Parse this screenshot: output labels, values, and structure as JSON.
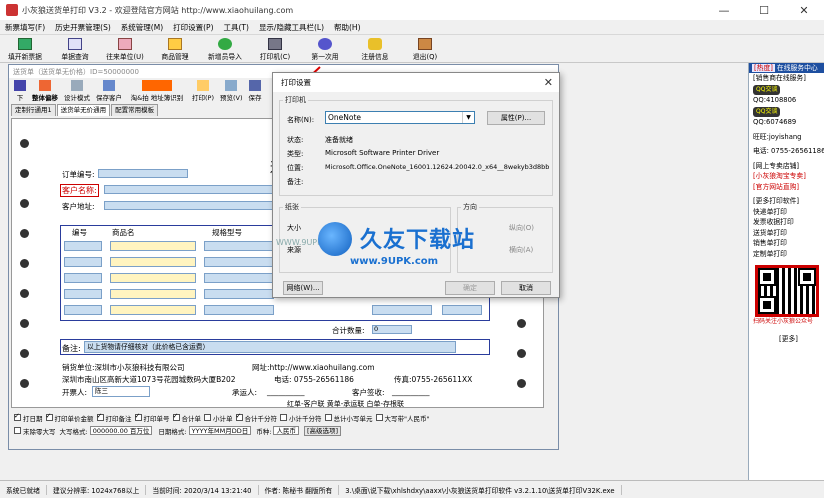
{
  "window": {
    "title": "小灰狼送货单打印 V3.2 - 欢迎登陆官方网站 http://www.xiaohuilang.com",
    "controls": [
      "—",
      "☐",
      "✕"
    ]
  },
  "menu": [
    "新票填写(F)",
    "历史开票管理(S)",
    "系统管理(M)",
    "打印设置(P)",
    "工具(T)",
    "显示/隐藏工具栏(L)",
    "帮助(H)"
  ],
  "toolbar": [
    {
      "label": "填开新票据",
      "icon": "new-doc-icon"
    },
    {
      "label": "单据查询",
      "icon": "query-icon"
    },
    {
      "label": "往来单位(U)",
      "icon": "company-icon"
    },
    {
      "label": "商品管理",
      "icon": "goods-icon"
    },
    {
      "label": "新增员导入",
      "icon": "import-icon"
    },
    {
      "label": "打印机(C)",
      "icon": "printer-icon"
    },
    {
      "label": "第一次用",
      "icon": "first-use-icon"
    },
    {
      "label": "注册信息",
      "icon": "register-icon"
    },
    {
      "label": "退出(Q)",
      "icon": "exit-icon"
    }
  ],
  "sub": {
    "title": "送货单（送货单无价格）ID=50000000",
    "tools": [
      "下",
      "整体偏移",
      "设计模式",
      "保存客户",
      "淘&拍 地址簿识别",
      "打印(P)",
      "预览(V)",
      "保存"
    ],
    "tabs": [
      "定制行通用1",
      "送货单无价通用",
      "配置常用模板"
    ],
    "active_tab": 1
  },
  "paper": {
    "title": "送",
    "order_no_label": "订单编号:",
    "customer_name_label": "客户名称:",
    "customer_addr_label": "客户地址:",
    "columns": [
      "编号",
      "商品名",
      "规格型号"
    ],
    "total_qty_label": "合计数量:",
    "total_qty_value": "0",
    "remark_label": "备注:",
    "remark_text": "以上货物请仔细核对（此价格已含运费）",
    "seller": "销货单位:深圳市小灰狼科技有限公司",
    "website": "网址:http://www.xiaohuilang.com",
    "address": "深圳市南山区高新大道1073号花园城数码大厦B202",
    "phone": "电话: 0755-26561186",
    "fax": "传真:0755-265611XX",
    "issuer_label": "开票人:",
    "issuer_value": "陈三",
    "carrier_label": "承运人:",
    "signer_label": "客户签收:",
    "copies": "红单-客户联    黄单-承运联    白单-存根联"
  },
  "options": {
    "row1": [
      {
        "label": "打日期",
        "on": true
      },
      {
        "label": "打印单价金额",
        "on": true
      },
      {
        "label": "打印备注",
        "on": true
      },
      {
        "label": "打印单号",
        "on": true
      },
      {
        "label": "合计单",
        "on": true
      },
      {
        "label": "小计单",
        "on": false
      },
      {
        "label": "合计千分符",
        "on": true
      },
      {
        "label": "小计千分符",
        "on": false
      },
      {
        "label": "总计小写单元",
        "on": false
      },
      {
        "label": "大写带\"人民币\"",
        "on": false
      }
    ],
    "row2": {
      "no_zero": "末除零大写",
      "case_label": "大写格式:",
      "case_value": "000000.00 百万位",
      "date_label": "日期格式:",
      "date_value": "YYYY年MM月DD日",
      "currency_label": "币种:",
      "currency_value": "人民币",
      "more_btn": "[高级选项]"
    }
  },
  "dialog": {
    "title": "打印设置",
    "close": "✕",
    "printer_group": "打印机",
    "name_label": "名称(N):",
    "name_value": "OneNote",
    "props_btn": "属性(P)...",
    "status_label": "状态:",
    "status_value": "准备就绪",
    "type_label": "类型:",
    "type_value": "Microsoft Software Printer Driver",
    "where_label": "位置:",
    "where_value": "Microsoft.Office.OneNote_16001.12624.20042.0_x64__8wekyb3d8bb",
    "comment_label": "备注:",
    "paper_group": "纸张",
    "size_label": "大小",
    "orient_group": "方向",
    "portrait": "纵向(O)",
    "landscape": "横向(A)",
    "source_label": "来源",
    "network_btn": "网络(W)...",
    "ok_btn": "确定",
    "cancel_btn": "取消"
  },
  "watermark": {
    "cn": "久友下载站",
    "url": "www.9UPK.com",
    "prefix": "WWW.9UPK.CO"
  },
  "side": {
    "header_hot": "[热度]",
    "header": "在线服务中心",
    "lines": [
      {
        "text": "[销售商在线服务]",
        "cls": ""
      },
      {
        "text": "QQ交谈",
        "cls": "qq"
      },
      {
        "text": "QQ:4108806",
        "cls": ""
      },
      {
        "text": "QQ交谈",
        "cls": "qq"
      },
      {
        "text": "QQ:6074689",
        "cls": ""
      },
      {
        "text": "",
        "cls": ""
      },
      {
        "text": "旺旺:joyishang",
        "cls": ""
      },
      {
        "text": "",
        "cls": ""
      },
      {
        "text": "电话: 0755-26561186",
        "cls": ""
      },
      {
        "text": "",
        "cls": ""
      },
      {
        "text": "[网上专卖店铺]",
        "cls": ""
      },
      {
        "text": "[小灰狼淘宝专卖]",
        "cls": "red"
      },
      {
        "text": "[官方网站直购]",
        "cls": "red"
      },
      {
        "text": "",
        "cls": ""
      },
      {
        "text": "[更多打印软件]",
        "cls": ""
      },
      {
        "text": "快递单打印",
        "cls": ""
      },
      {
        "text": "发票收据打印",
        "cls": ""
      },
      {
        "text": "送货单打印",
        "cls": ""
      },
      {
        "text": "销售单打印",
        "cls": ""
      },
      {
        "text": "定制单打印",
        "cls": ""
      }
    ],
    "ad_caption": "扫码关注小灰狼公众号",
    "more": "[更多]"
  },
  "status": [
    "系统已就绪",
    "建议分辨率: 1024x768以上",
    "当前时间: 2020/3/14 13:21:40",
    "作者: 陈秘书 翻版所有",
    "3.\\桌面\\说下载\\xhlshdxy\\aaxx\\小灰狼送货单打印软件 v3.2.1.10\\送货单打印V32K.exe"
  ]
}
